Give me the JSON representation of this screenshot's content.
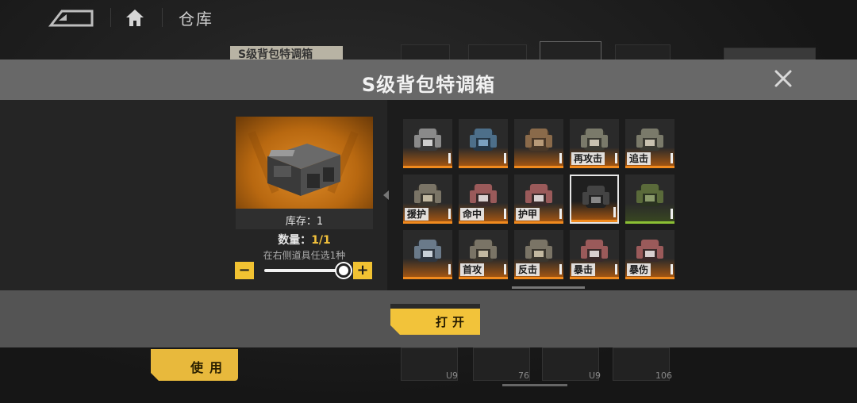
{
  "header": {
    "title": "仓库"
  },
  "background": {
    "category_tag": "S级背包特调箱",
    "use_button": "使用",
    "counts": [
      "U9",
      "76",
      "U9",
      "106"
    ]
  },
  "modal": {
    "title": "S级背包特调箱",
    "stock_text": "库存：1",
    "quantity_label": "数量：",
    "quantity_value": "1/1",
    "hint": "在右侧道具任选1种",
    "minus_label": "−",
    "plus_label": "+",
    "slider_fraction": 1.0,
    "open_button": "打开",
    "items": [
      {
        "label": ""
      },
      {
        "label": ""
      },
      {
        "label": ""
      },
      {
        "label": "再攻击"
      },
      {
        "label": "追击"
      },
      {
        "label": "援护"
      },
      {
        "label": "命中"
      },
      {
        "label": "护甲"
      },
      {
        "label": "",
        "selected": true
      },
      {
        "label": "",
        "variant": "green"
      },
      {
        "label": ""
      },
      {
        "label": "首攻"
      },
      {
        "label": "反击"
      },
      {
        "label": "暴击"
      },
      {
        "label": "暴伤"
      }
    ]
  },
  "colors": {
    "accent": "#f2c33a",
    "rarity_orange": "#f08a1e",
    "rarity_green": "#8bbf34"
  }
}
